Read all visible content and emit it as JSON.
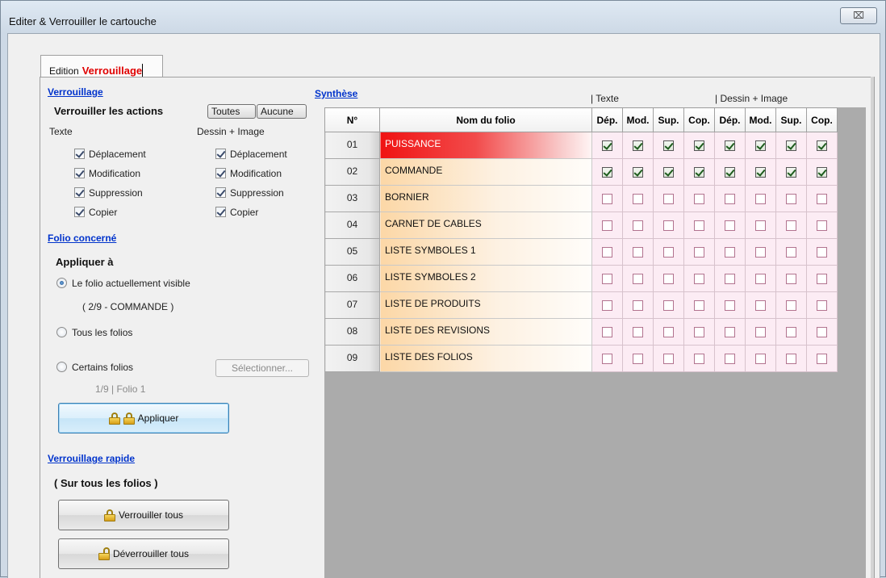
{
  "window": {
    "title": "Editer & Verrouiller le cartouche",
    "close_glyph": "⌧"
  },
  "tabs": [
    {
      "label": "Edition"
    },
    {
      "label": "Verrouillage",
      "active": true
    }
  ],
  "lock_section": {
    "link": "Verrouillage",
    "actions_label": "Verrouiller les actions",
    "all_btn": "Toutes",
    "none_btn": "Aucune",
    "text_col": "Texte",
    "drawing_col": "Dessin + Image",
    "text_options": [
      {
        "label": "Déplacement",
        "checked": true
      },
      {
        "label": "Modification",
        "checked": true
      },
      {
        "label": "Suppression",
        "checked": true
      },
      {
        "label": "Copier",
        "checked": true
      }
    ],
    "drawing_options": [
      {
        "label": "Déplacement",
        "checked": true
      },
      {
        "label": "Modification",
        "checked": true
      },
      {
        "label": "Suppression",
        "checked": true
      },
      {
        "label": "Copier",
        "checked": true
      }
    ]
  },
  "folio_section": {
    "link": "Folio concerné",
    "apply_to": "Appliquer à",
    "radio_current": "Le folio actuellement visible",
    "current_folio": "( 2/9 - COMMANDE )",
    "radio_all": "Tous les folios",
    "radio_some": "Certains folios",
    "select_btn": "Sélectionner...",
    "some_info": "1/9 | Folio 1",
    "apply_btn": "Appliquer",
    "selected_radio": "current"
  },
  "quick_section": {
    "link": "Verrouillage rapide",
    "subtitle": "( Sur tous les folios )",
    "lock_all_btn": "Verrouiller tous",
    "unlock_all_btn": "Déverrouiller tous"
  },
  "synthesis": {
    "link": "Synthèse",
    "group_text": "|  Texte",
    "group_drawing": "|  Dessin + Image",
    "headers": {
      "no": "N°",
      "name": "Nom du folio",
      "cols": [
        "Dép.",
        "Mod.",
        "Sup.",
        "Cop.",
        "Dép.",
        "Mod.",
        "Sup.",
        "Cop."
      ]
    },
    "rows": [
      {
        "no": "01",
        "name": "PUISSANCE",
        "selected": true,
        "checks": [
          true,
          true,
          true,
          true,
          true,
          true,
          true,
          true
        ]
      },
      {
        "no": "02",
        "name": "COMMANDE",
        "selected": false,
        "checks": [
          true,
          true,
          true,
          true,
          true,
          true,
          true,
          true
        ]
      },
      {
        "no": "03",
        "name": "BORNIER",
        "selected": false,
        "checks": [
          false,
          false,
          false,
          false,
          false,
          false,
          false,
          false
        ]
      },
      {
        "no": "04",
        "name": "CARNET DE CABLES",
        "selected": false,
        "checks": [
          false,
          false,
          false,
          false,
          false,
          false,
          false,
          false
        ]
      },
      {
        "no": "05",
        "name": "LISTE SYMBOLES 1",
        "selected": false,
        "checks": [
          false,
          false,
          false,
          false,
          false,
          false,
          false,
          false
        ]
      },
      {
        "no": "06",
        "name": "LISTE SYMBOLES 2",
        "selected": false,
        "checks": [
          false,
          false,
          false,
          false,
          false,
          false,
          false,
          false
        ]
      },
      {
        "no": "07",
        "name": "LISTE DE PRODUITS",
        "selected": false,
        "checks": [
          false,
          false,
          false,
          false,
          false,
          false,
          false,
          false
        ]
      },
      {
        "no": "08",
        "name": "LISTE DES REVISIONS",
        "selected": false,
        "checks": [
          false,
          false,
          false,
          false,
          false,
          false,
          false,
          false
        ]
      },
      {
        "no": "09",
        "name": "LISTE DES FOLIOS",
        "selected": false,
        "checks": [
          false,
          false,
          false,
          false,
          false,
          false,
          false,
          false
        ]
      }
    ]
  },
  "colors": {
    "link": "#0033cc",
    "active_tab": "#e00000",
    "grid_background": "#ababab",
    "selected_row": "#f01313"
  }
}
